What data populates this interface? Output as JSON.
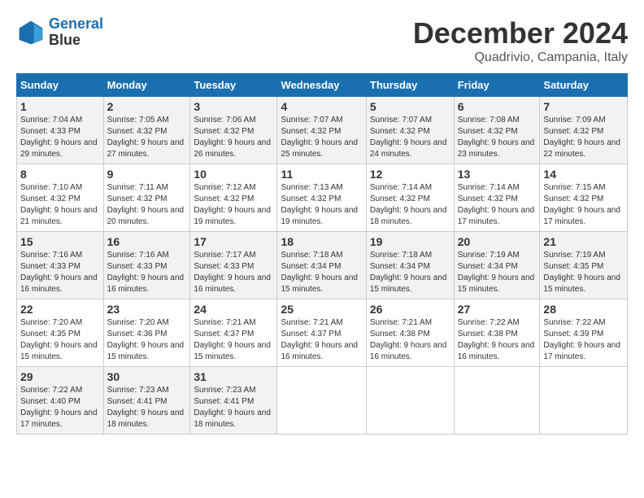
{
  "logo": {
    "line1": "General",
    "line2": "Blue"
  },
  "title": "December 2024",
  "subtitle": "Quadrivio, Campania, Italy",
  "headers": [
    "Sunday",
    "Monday",
    "Tuesday",
    "Wednesday",
    "Thursday",
    "Friday",
    "Saturday"
  ],
  "weeks": [
    [
      {
        "day": "1",
        "sunrise": "7:04 AM",
        "sunset": "4:33 PM",
        "daylight": "9 hours and 29 minutes."
      },
      {
        "day": "2",
        "sunrise": "7:05 AM",
        "sunset": "4:32 PM",
        "daylight": "9 hours and 27 minutes."
      },
      {
        "day": "3",
        "sunrise": "7:06 AM",
        "sunset": "4:32 PM",
        "daylight": "9 hours and 26 minutes."
      },
      {
        "day": "4",
        "sunrise": "7:07 AM",
        "sunset": "4:32 PM",
        "daylight": "9 hours and 25 minutes."
      },
      {
        "day": "5",
        "sunrise": "7:07 AM",
        "sunset": "4:32 PM",
        "daylight": "9 hours and 24 minutes."
      },
      {
        "day": "6",
        "sunrise": "7:08 AM",
        "sunset": "4:32 PM",
        "daylight": "9 hours and 23 minutes."
      },
      {
        "day": "7",
        "sunrise": "7:09 AM",
        "sunset": "4:32 PM",
        "daylight": "9 hours and 22 minutes."
      }
    ],
    [
      {
        "day": "8",
        "sunrise": "7:10 AM",
        "sunset": "4:32 PM",
        "daylight": "9 hours and 21 minutes."
      },
      {
        "day": "9",
        "sunrise": "7:11 AM",
        "sunset": "4:32 PM",
        "daylight": "9 hours and 20 minutes."
      },
      {
        "day": "10",
        "sunrise": "7:12 AM",
        "sunset": "4:32 PM",
        "daylight": "9 hours and 19 minutes."
      },
      {
        "day": "11",
        "sunrise": "7:13 AM",
        "sunset": "4:32 PM",
        "daylight": "9 hours and 19 minutes."
      },
      {
        "day": "12",
        "sunrise": "7:14 AM",
        "sunset": "4:32 PM",
        "daylight": "9 hours and 18 minutes."
      },
      {
        "day": "13",
        "sunrise": "7:14 AM",
        "sunset": "4:32 PM",
        "daylight": "9 hours and 17 minutes."
      },
      {
        "day": "14",
        "sunrise": "7:15 AM",
        "sunset": "4:32 PM",
        "daylight": "9 hours and 17 minutes."
      }
    ],
    [
      {
        "day": "15",
        "sunrise": "7:16 AM",
        "sunset": "4:33 PM",
        "daylight": "9 hours and 16 minutes."
      },
      {
        "day": "16",
        "sunrise": "7:16 AM",
        "sunset": "4:33 PM",
        "daylight": "9 hours and 16 minutes."
      },
      {
        "day": "17",
        "sunrise": "7:17 AM",
        "sunset": "4:33 PM",
        "daylight": "9 hours and 16 minutes."
      },
      {
        "day": "18",
        "sunrise": "7:18 AM",
        "sunset": "4:34 PM",
        "daylight": "9 hours and 15 minutes."
      },
      {
        "day": "19",
        "sunrise": "7:18 AM",
        "sunset": "4:34 PM",
        "daylight": "9 hours and 15 minutes."
      },
      {
        "day": "20",
        "sunrise": "7:19 AM",
        "sunset": "4:34 PM",
        "daylight": "9 hours and 15 minutes."
      },
      {
        "day": "21",
        "sunrise": "7:19 AM",
        "sunset": "4:35 PM",
        "daylight": "9 hours and 15 minutes."
      }
    ],
    [
      {
        "day": "22",
        "sunrise": "7:20 AM",
        "sunset": "4:35 PM",
        "daylight": "9 hours and 15 minutes."
      },
      {
        "day": "23",
        "sunrise": "7:20 AM",
        "sunset": "4:36 PM",
        "daylight": "9 hours and 15 minutes."
      },
      {
        "day": "24",
        "sunrise": "7:21 AM",
        "sunset": "4:37 PM",
        "daylight": "9 hours and 15 minutes."
      },
      {
        "day": "25",
        "sunrise": "7:21 AM",
        "sunset": "4:37 PM",
        "daylight": "9 hours and 16 minutes."
      },
      {
        "day": "26",
        "sunrise": "7:21 AM",
        "sunset": "4:38 PM",
        "daylight": "9 hours and 16 minutes."
      },
      {
        "day": "27",
        "sunrise": "7:22 AM",
        "sunset": "4:38 PM",
        "daylight": "9 hours and 16 minutes."
      },
      {
        "day": "28",
        "sunrise": "7:22 AM",
        "sunset": "4:39 PM",
        "daylight": "9 hours and 17 minutes."
      }
    ],
    [
      {
        "day": "29",
        "sunrise": "7:22 AM",
        "sunset": "4:40 PM",
        "daylight": "9 hours and 17 minutes."
      },
      {
        "day": "30",
        "sunrise": "7:23 AM",
        "sunset": "4:41 PM",
        "daylight": "9 hours and 18 minutes."
      },
      {
        "day": "31",
        "sunrise": "7:23 AM",
        "sunset": "4:41 PM",
        "daylight": "9 hours and 18 minutes."
      },
      null,
      null,
      null,
      null
    ]
  ]
}
